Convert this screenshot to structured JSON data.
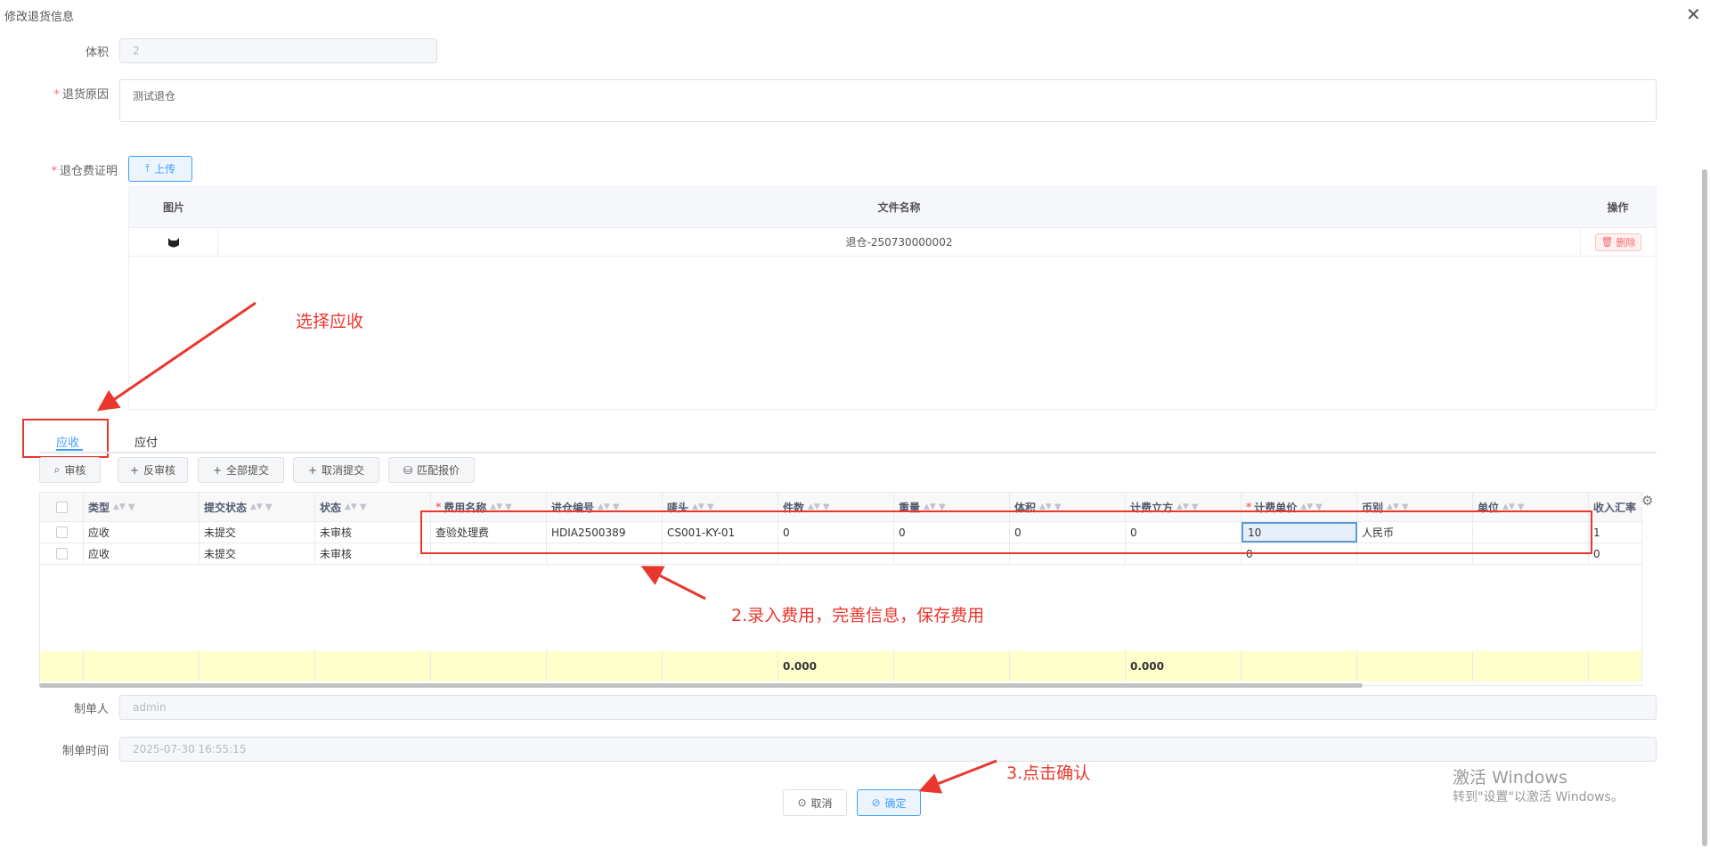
{
  "dialog": {
    "title": "修改退货信息"
  },
  "form": {
    "volume": {
      "label": "体积",
      "value": "2"
    },
    "return_reason": {
      "label": "退货原因",
      "value": "测试退仓"
    },
    "proof": {
      "label": "退仓费证明",
      "upload_label": "上传"
    }
  },
  "file_table": {
    "headers": {
      "image": "图片",
      "filename": "文件名称",
      "action": "操作"
    },
    "rows": [
      {
        "filename": "退仓-250730000002",
        "delete_label": "删除"
      }
    ]
  },
  "annotations": {
    "step1": "选择应收",
    "step2": "2.录入费用，完善信息，保存费用",
    "step3": "3.点击确认"
  },
  "tabs": [
    {
      "label": "应收",
      "active": true
    },
    {
      "label": "应付",
      "active": false
    }
  ],
  "toolbar": {
    "audit": "审核",
    "unaudit": "反审核",
    "submit_all": "全部提交",
    "cancel_submit": "取消提交",
    "match_quote": "匹配报价"
  },
  "grid": {
    "headers": [
      "类型",
      "提交状态",
      "状态",
      "费用名称",
      "进仓编号",
      "唛头",
      "件数",
      "重量",
      "体积",
      "计费立方",
      "计费单价",
      "币别",
      "单位",
      "收入汇率"
    ],
    "rows": [
      [
        "应收",
        "未提交",
        "未审核",
        "查验处理费",
        "HDIA2500389",
        "CS001-KY-01",
        "0",
        "0",
        "0",
        "0",
        "10",
        "人民币",
        "",
        "1"
      ],
      [
        "应收",
        "未提交",
        "未审核",
        "",
        "",
        "",
        "",
        "",
        "",
        "",
        "0",
        "",
        "",
        "0"
      ]
    ],
    "summary": {
      "pieces": "0.000",
      "billing_cbm": "0.000"
    }
  },
  "maker": {
    "label": "制单人",
    "value": "admin"
  },
  "make_time": {
    "label": "制单时间",
    "value": "2025-07-30 16:55:15"
  },
  "footer": {
    "cancel": "取消",
    "confirm": "确定"
  },
  "watermark": {
    "line1": "激活 Windows",
    "line2": "转到\"设置\"以激活 Windows。"
  }
}
